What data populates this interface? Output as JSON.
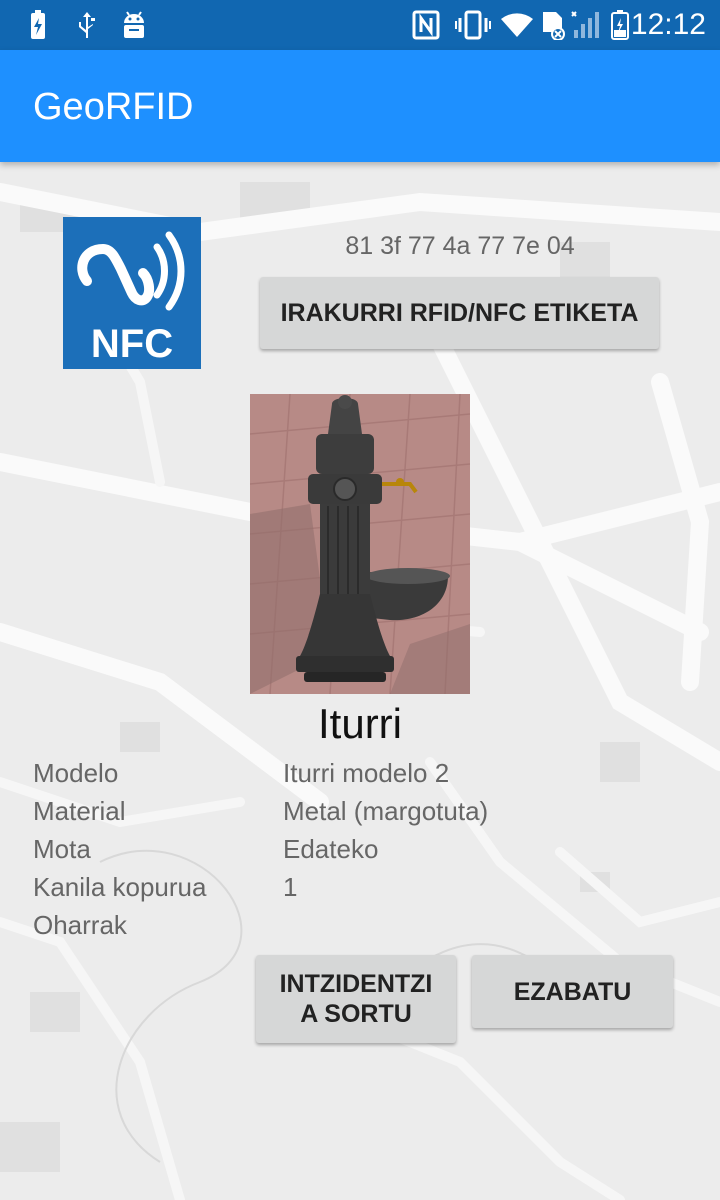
{
  "status_bar": {
    "time": "12:12",
    "icons_left": [
      "battery-charging-icon",
      "usb-icon",
      "android-debug-icon"
    ],
    "icons_right": [
      "nfc-icon",
      "vibrate-icon",
      "wifi-icon",
      "no-sim-icon",
      "signal-icon",
      "battery-icon"
    ]
  },
  "app_bar": {
    "title": "GeoRFID"
  },
  "tag": {
    "uid": "81 3f 77 4a 77 7e 04",
    "read_button": "IRAKURRI RFID/NFC ETIKETA",
    "logo_text": "NFC"
  },
  "item": {
    "name": "Iturri",
    "properties": [
      {
        "label": "Modelo",
        "value": "Iturri modelo 2"
      },
      {
        "label": "Material",
        "value": "Metal (margotuta)"
      },
      {
        "label": "Mota",
        "value": "Edateko"
      },
      {
        "label": "Kanila kopurua",
        "value": "1"
      },
      {
        "label": "Oharrak",
        "value": ""
      }
    ]
  },
  "actions": {
    "incident_line1": "INTZIDENTZI",
    "incident_line2": "A SORTU",
    "delete": "EZABATU"
  },
  "colors": {
    "status_bar": "#1167b1",
    "app_bar": "#1e90ff",
    "nfc_logo": "#1c6fb9",
    "button": "#d6d7d7"
  }
}
